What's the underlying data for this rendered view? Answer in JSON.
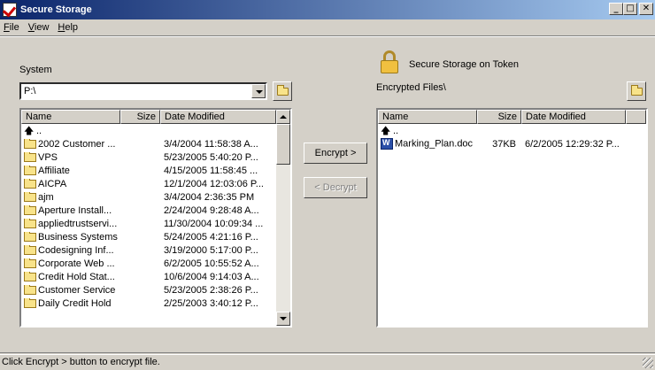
{
  "window": {
    "title": "Secure Storage"
  },
  "menu": [
    "File",
    "View",
    "Help"
  ],
  "left": {
    "label": "System",
    "drive_value": "P:\\",
    "columns": [
      "Name",
      "Size",
      "Date Modified"
    ],
    "rows": [
      {
        "name": "..",
        "type": "up",
        "size": "",
        "date": ""
      },
      {
        "name": "2002 Customer ...",
        "type": "folder",
        "size": "",
        "date": "3/4/2004 11:58:38 A..."
      },
      {
        "name": "VPS",
        "type": "folder",
        "size": "",
        "date": "5/23/2005 5:40:20 P..."
      },
      {
        "name": "Affiliate",
        "type": "folder",
        "size": "",
        "date": "4/15/2005 11:58:45 ..."
      },
      {
        "name": "AICPA",
        "type": "folder",
        "size": "",
        "date": "12/1/2004 12:03:06 P..."
      },
      {
        "name": "ajm",
        "type": "folder",
        "size": "",
        "date": "3/4/2004 2:36:35 PM"
      },
      {
        "name": "Aperture Install...",
        "type": "folder",
        "size": "",
        "date": "2/24/2004 9:28:48 A..."
      },
      {
        "name": "appliedtrustservi...",
        "type": "folder",
        "size": "",
        "date": "11/30/2004 10:09:34 ..."
      },
      {
        "name": "Business Systems",
        "type": "folder",
        "size": "",
        "date": "5/24/2005 4:21:16 P..."
      },
      {
        "name": "Codesigning Inf...",
        "type": "folder",
        "size": "",
        "date": "3/19/2000 5:17:00 P..."
      },
      {
        "name": "Corporate Web ...",
        "type": "folder",
        "size": "",
        "date": "6/2/2005 10:55:52 A..."
      },
      {
        "name": "Credit Hold Stat...",
        "type": "folder",
        "size": "",
        "date": "10/6/2004 9:14:03 A..."
      },
      {
        "name": "Customer Service",
        "type": "folder",
        "size": "",
        "date": "5/23/2005 2:38:26 P..."
      },
      {
        "name": "Daily Credit Hold",
        "type": "folder",
        "size": "",
        "date": "2/25/2003 3:40:12 P..."
      }
    ]
  },
  "actions": {
    "encrypt": "Encrypt >",
    "decrypt": "< Decrypt"
  },
  "right": {
    "heading": "Secure Storage on Token",
    "label": "Encrypted Files\\",
    "columns": [
      "Name",
      "Size",
      "Date Modified"
    ],
    "rows": [
      {
        "name": "..",
        "type": "up",
        "size": "",
        "date": ""
      },
      {
        "name": "Marking_Plan.doc",
        "type": "doc",
        "size": "37KB",
        "date": "6/2/2005 12:29:32 P..."
      }
    ]
  },
  "status": "Click Encrypt > button to encrypt file."
}
